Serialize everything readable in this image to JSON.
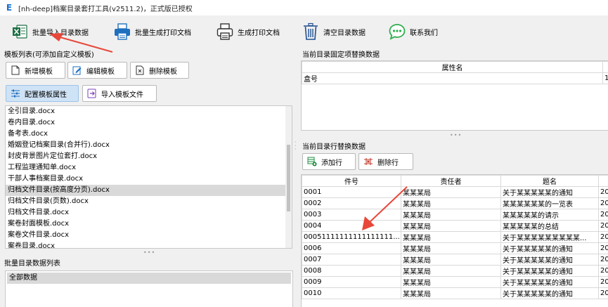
{
  "window": {
    "icon_letter": "E",
    "title": "[nh-deep]档案目录套打工具(v2511.2)，正式版已授权"
  },
  "toolbar": {
    "batch_import": "批量导入目录数据",
    "batch_generate": "批量生成打印文档",
    "generate_print": "生成打印文档",
    "clear_data": "清空目录数据",
    "contact_us": "联系我们"
  },
  "template_panel": {
    "title": "模板列表(可添加自定义模板)",
    "new_btn": "新增模板",
    "edit_btn": "编辑模板",
    "delete_btn": "删除模板",
    "config_btn": "配置模板属性",
    "import_btn": "导入模板文件",
    "items": [
      "全引目录.docx",
      "卷内目录.docx",
      "备考表.docx",
      "婚姻登记档案目录(合并行).docx",
      "封皮背景图片定位套打.docx",
      "工程监理通知单.docx",
      "干部人事档案目录.docx",
      "归档文件目录(按高度分页).docx",
      "归档文件目录(页数).docx",
      "归档文件目录.docx",
      "案卷封面模板.docx",
      "案卷文件目录.docx",
      "案卷目录.docx"
    ]
  },
  "batch_panel": {
    "title": "批量目录数据列表",
    "items": [
      "全部数据"
    ]
  },
  "fixed_panel": {
    "title": "当前目录固定项替换数据",
    "col_header": "属性名",
    "row_name": "盒号",
    "row_value": "1"
  },
  "row_panel": {
    "title": "当前目录行替换数据",
    "add_btn": "添加行",
    "delete_btn": "删除行",
    "headers": [
      "件号",
      "责任者",
      "题名",
      ""
    ],
    "rows": [
      [
        "0001",
        "某某某局",
        "关于某某某某某的通知",
        "20"
      ],
      [
        "0002",
        "某某某局",
        "某某某某某某的一览表",
        "20"
      ],
      [
        "0003",
        "某某某局",
        "某某某某某的请示",
        "20"
      ],
      [
        "0004",
        "某某某局",
        "某某某某某的总结",
        "20"
      ],
      [
        "00051111111111111111...",
        "某某某局",
        "关于某某某某某某某某某...",
        "20"
      ],
      [
        "0006",
        "某某某局",
        "关于某某某某某的通知",
        "20"
      ],
      [
        "0007",
        "某某某局",
        "关于某某某某某的通知",
        "20"
      ],
      [
        "0008",
        "某某某局",
        "关于某某某某某的通知",
        "20"
      ],
      [
        "0009",
        "某某某局",
        "关于某某某某某的通知",
        "20"
      ],
      [
        "0010",
        "某某某局",
        "关于某某某某某的通知",
        "20"
      ]
    ]
  },
  "colors": {
    "arrow": "#e8473a",
    "selected_row": "#d9d9d9",
    "active_button": "#cfe3f6"
  }
}
